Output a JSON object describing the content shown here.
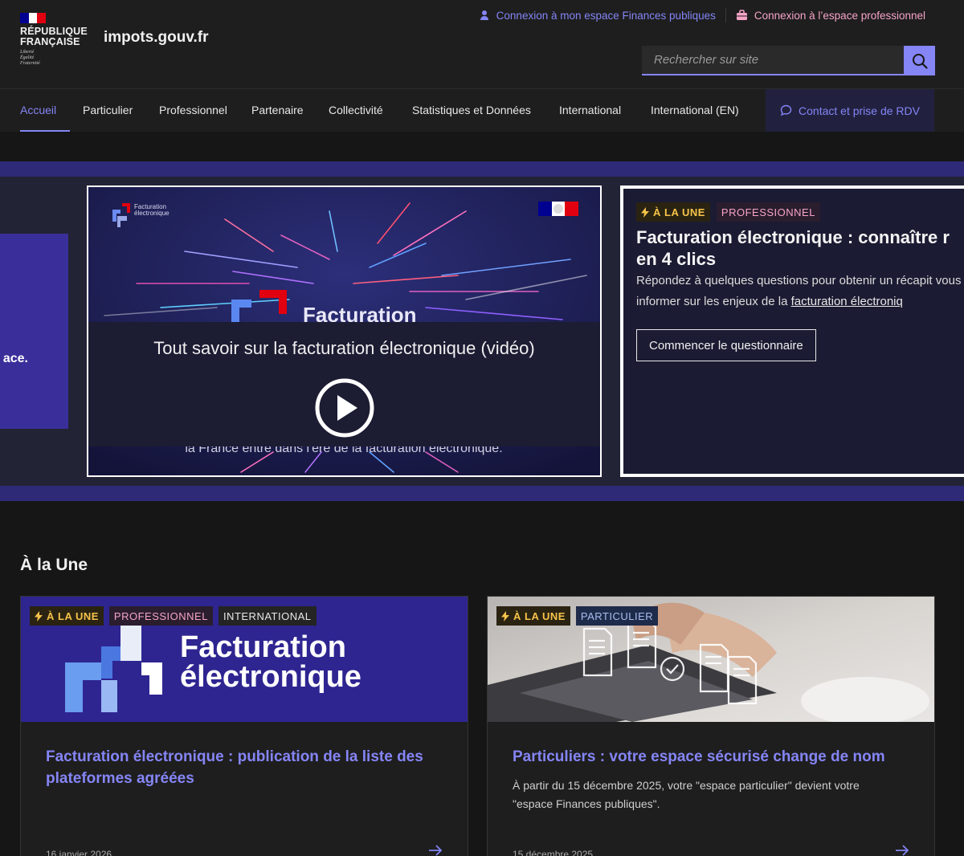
{
  "header": {
    "republic_text": "RÉPUBLIQUE\nFRANÇAISE",
    "motto": "Liberté\nÉgalité\nFraternité",
    "site_name": "impots.gouv.fr",
    "tool_links": {
      "espace_finances": "Connexion à mon espace Finances publiques",
      "espace_pro": "Connexion à l’espace professionnel"
    },
    "search": {
      "placeholder": "Rechercher sur site"
    },
    "flag_colors": [
      "#000091",
      "#ffffff",
      "#e1000f"
    ]
  },
  "nav": {
    "items": [
      {
        "label": "Accueil",
        "active": true
      },
      {
        "label": "Particulier"
      },
      {
        "label": "Professionnel"
      },
      {
        "label": "Partenaire"
      },
      {
        "label": "Collectivité"
      },
      {
        "label": "Statistiques et Données"
      },
      {
        "label": "International"
      },
      {
        "label": "International (EN)"
      }
    ],
    "contact": "Contact et prise de RDV"
  },
  "carousel": {
    "left_peek_text": "ace.",
    "video": {
      "brand_text": "Facturation\nélectronique",
      "watermark_title": "Facturation",
      "title": "Tout savoir sur la facturation électronique (vidéo)",
      "subtitle": "la France entre dans l'ère de la facturation électronique."
    },
    "feature": {
      "tags": {
        "une": "À LA UNE",
        "pro": "PROFESSIONNEL"
      },
      "title": "Facturation électronique : connaître r\nen 4 clics",
      "desc_before": "Répondez à quelques questions pour obtenir un récapit vous informer sur les enjeux de la ",
      "desc_link": "facturation électroniq",
      "button": "Commencer le questionnaire"
    }
  },
  "section": {
    "title": "À la Une",
    "cards": [
      {
        "tags": {
          "une": "À LA UNE",
          "pro": "PROFESSIONNEL",
          "intl": "INTERNATIONAL"
        },
        "image_text": "Facturation\nélectronique",
        "title": "Facturation électronique : publication de la liste des plateformes agréées",
        "date": "16 janvier 2026"
      },
      {
        "tags": {
          "une": "À LA UNE",
          "part": "PARTICULIER"
        },
        "title": "Particuliers : votre espace sécurisé change de nom",
        "desc": "À partir du 15 décembre 2025, votre \"espace particulier\" devient votre \"espace Finances publiques\".",
        "date": "15 décembre 2025"
      }
    ]
  },
  "colors": {
    "accent": "#8585f6",
    "page_bg": "#161616",
    "header_bg": "#1e1e1e",
    "band_stripe": "#2e2a78",
    "tag_une": "#f6c34a",
    "tag_pro": "#f6a4c6"
  }
}
